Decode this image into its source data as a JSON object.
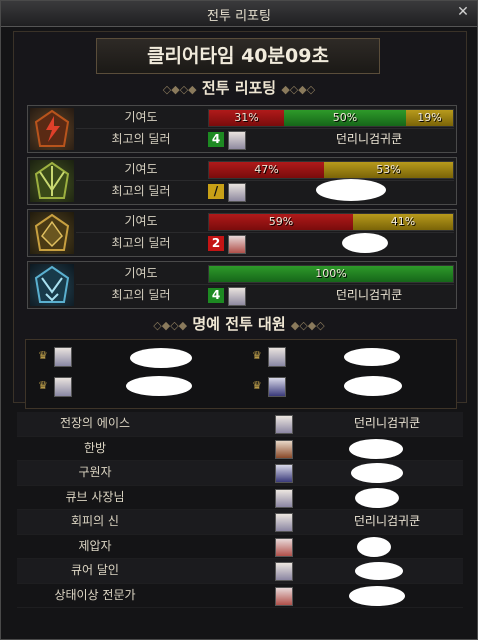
{
  "window": {
    "title": "전투 리포팅",
    "close_icon": "close-icon"
  },
  "clear_time": "클리어타임  40분09초",
  "report_header": "전투 리포팅",
  "honor_header": "명예 전투 대원",
  "contribution_label": "기여도",
  "top_dealer_label": "최고의 딜러",
  "members": [
    {
      "icon": "fire-class-icon",
      "bars": [
        {
          "pct": "31%",
          "value": 31,
          "color": "red"
        },
        {
          "pct": "50%",
          "value": 50,
          "color": "green"
        },
        {
          "pct": "19%",
          "value": 19,
          "color": "yellow"
        }
      ],
      "rank": "4",
      "dealer": "던리니검귀쿤"
    },
    {
      "icon": "nature-class-icon",
      "bars": [
        {
          "pct": "47%",
          "value": 47,
          "color": "red"
        },
        {
          "pct": "53%",
          "value": 53,
          "color": "yellow"
        }
      ],
      "rank": "/",
      "dealer": ""
    },
    {
      "icon": "gold-class-icon",
      "bars": [
        {
          "pct": "59%",
          "value": 59,
          "color": "red"
        },
        {
          "pct": "41%",
          "value": 41,
          "color": "yellow"
        }
      ],
      "rank": "2",
      "dealer": ""
    },
    {
      "icon": "ice-class-icon",
      "bars": [
        {
          "pct": "100%",
          "value": 100,
          "color": "green"
        }
      ],
      "rank": "4",
      "dealer": "던리니검귀쿤"
    }
  ],
  "awards": [
    {
      "title": "전장의 에이스",
      "name": "던리니검귀쿤"
    },
    {
      "title": "한방",
      "name": ""
    },
    {
      "title": "구원자",
      "name": ""
    },
    {
      "title": "큐브 사장님",
      "name": ""
    },
    {
      "title": "회피의 신",
      "name": "던리니검귀쿤"
    },
    {
      "title": "제압자",
      "name": ""
    },
    {
      "title": "큐어 달인",
      "name": ""
    },
    {
      "title": "상태이상 전문가",
      "name": ""
    }
  ]
}
